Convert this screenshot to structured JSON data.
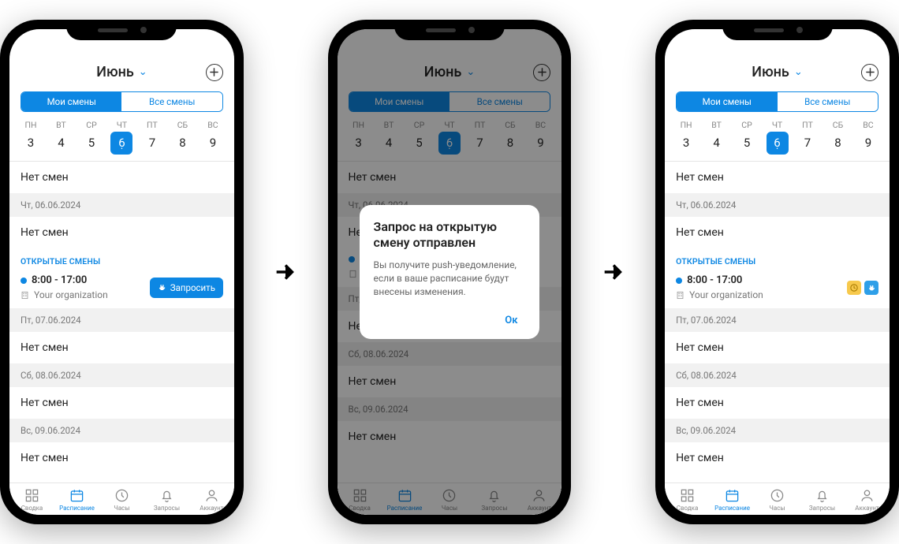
{
  "header": {
    "month": "Июнь"
  },
  "segments": {
    "my": "Мои смены",
    "all": "Все смены"
  },
  "week": {
    "days": [
      {
        "label": "ПН",
        "num": "3"
      },
      {
        "label": "ВТ",
        "num": "4"
      },
      {
        "label": "СР",
        "num": "5"
      },
      {
        "label": "ЧТ",
        "num": "6",
        "selected": true
      },
      {
        "label": "ПТ",
        "num": "7"
      },
      {
        "label": "СБ",
        "num": "8"
      },
      {
        "label": "ВС",
        "num": "9"
      }
    ]
  },
  "strings": {
    "no_shifts": "Нет смен",
    "open_shifts": "ОТКРЫТЫЕ СМЕНЫ",
    "request": "Запросить"
  },
  "dates": {
    "d1": "Чт, 06.06.2024",
    "d2": "Пт, 07.06.2024",
    "d3": "Сб, 08.06.2024",
    "d4": "Вс, 09.06.2024"
  },
  "shift": {
    "time": "8:00 - 17:00",
    "org": "Your organization"
  },
  "tabs": {
    "summary": "Сводка",
    "schedule": "Расписание",
    "hours": "Часы",
    "requests": "Запросы",
    "account": "Аккаунт"
  },
  "dialog": {
    "title": "Запрос на открытую смену отправлен",
    "body": "Вы получите push-уведомление, если в ваше расписание будут внесены изменения.",
    "ok": "Ок"
  }
}
